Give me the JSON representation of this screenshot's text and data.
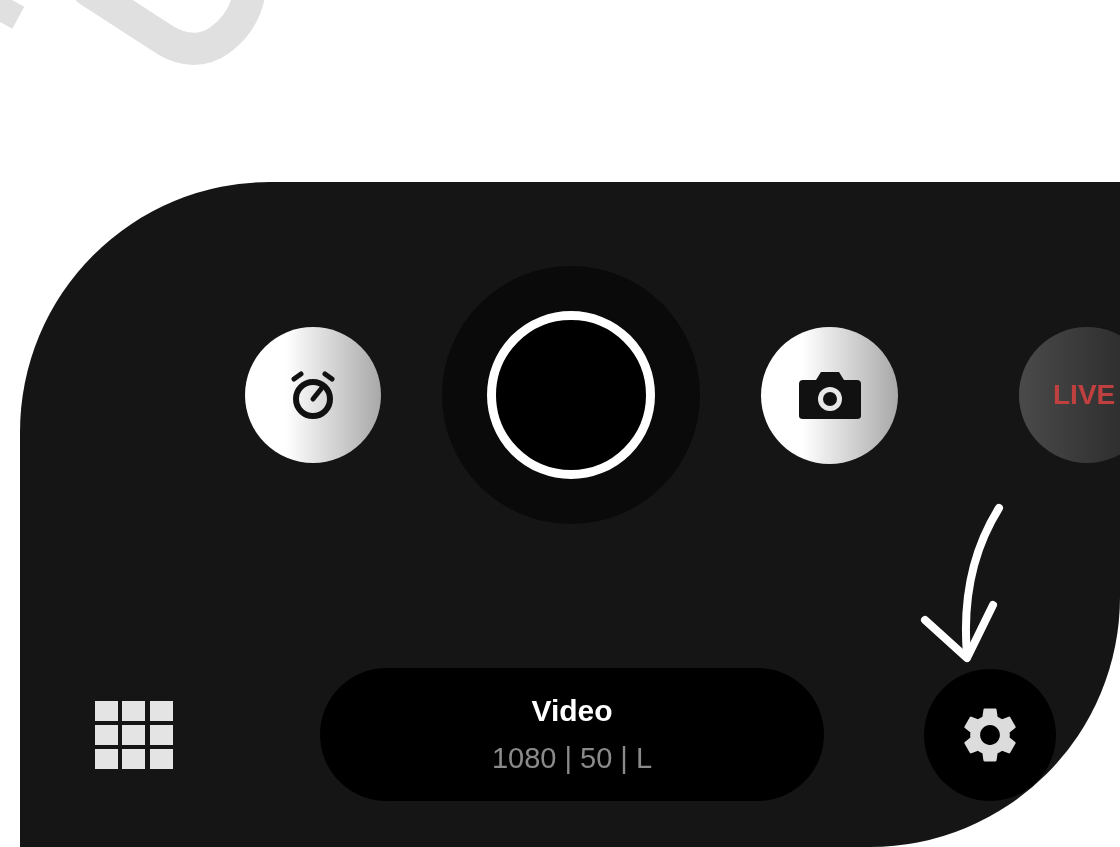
{
  "controls": [
    {
      "kind": "timer",
      "disabled": false
    },
    {
      "kind": "shutter",
      "disabled": false
    },
    {
      "kind": "photo",
      "disabled": false
    },
    {
      "kind": "live",
      "label": "LIVE",
      "disabled": true
    }
  ],
  "mode": {
    "title": "Video",
    "settings": "1080 | 50 | L"
  }
}
